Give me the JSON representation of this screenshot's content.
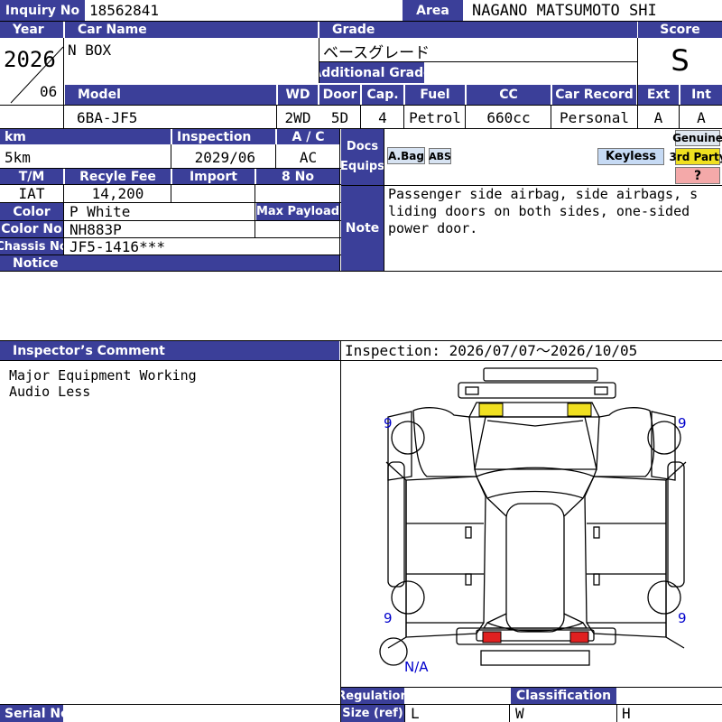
{
  "labels": {
    "inquiry_no": "Inquiry No",
    "area": "Area",
    "year": "Year",
    "car_name": "Car Name",
    "grade": "Grade",
    "score": "Score",
    "additional_grade": "Additional Grade",
    "model": "Model",
    "wd": "WD",
    "door": "Door",
    "cap": "Cap.",
    "fuel": "Fuel",
    "cc": "CC",
    "car_record": "Car Record",
    "ext": "Ext",
    "int": "Int",
    "km": "km",
    "inspection": "Inspection",
    "ac": "A / C",
    "docs": "Docs",
    "equips": "Equips",
    "tm": "T/M",
    "recycle_fee": "Recyle Fee",
    "import": "Import",
    "eight_no": "8 No",
    "color": "Color",
    "max_payload": "Max Payload",
    "color_no": "Color No",
    "note": "Note",
    "chassis_no": "Chassis No",
    "notice": "Notice",
    "inspector_comment": "Inspector’s Comment",
    "regulation": "Regulation",
    "classification": "Classification",
    "size_ref": "Size (ref)",
    "serial_no": "Serial No",
    "l": "L",
    "w": "W",
    "h": "H"
  },
  "vehicle": {
    "inquiry_no": "18562841",
    "area": "NAGANO MATSUMOTO SHI",
    "year": "2026",
    "month": "06",
    "car_name": "N BOX",
    "grade": "ベースグレード",
    "additional_grade": "",
    "score": "S",
    "model": "6BA-JF5",
    "wd": "2WD",
    "door": "5D",
    "cap": "4",
    "fuel": "Petrol",
    "cc": "660cc",
    "car_record": "Personal",
    "ext": "A",
    "int": "A",
    "km": "5km",
    "inspection": "2029/06",
    "ac": "AC",
    "tm": "IAT",
    "recycle_fee": "14,200",
    "color": "P White",
    "color_no": "NH883P",
    "chassis_no": "JF5-1416***",
    "note": "Passenger side airbag, side airbags, sliding doors on both sides, one-sided power door."
  },
  "equipment": {
    "airbag": "A.Bag",
    "abs": "ABS",
    "keyless": "Keyless",
    "genuine": "Genuine",
    "third_party": "3rd Party",
    "unknown": "?"
  },
  "comments": {
    "lines": [
      "Major Equipment Working",
      "Audio Less"
    ],
    "inspection_period": "Inspection: 2026/07/07～2026/10/05"
  },
  "diagram": {
    "tire_marks": [
      "9",
      "9",
      "9",
      "9"
    ],
    "spare_tire": "N/A"
  },
  "colors": {
    "header": "#3b3f99",
    "highlight_yellow": "#f0e020",
    "highlight_red": "#e02020",
    "keyless_bg": "#c6daf4",
    "genuine_bg": "#dfe7f0",
    "unknown_bg": "#f4a9a9"
  }
}
